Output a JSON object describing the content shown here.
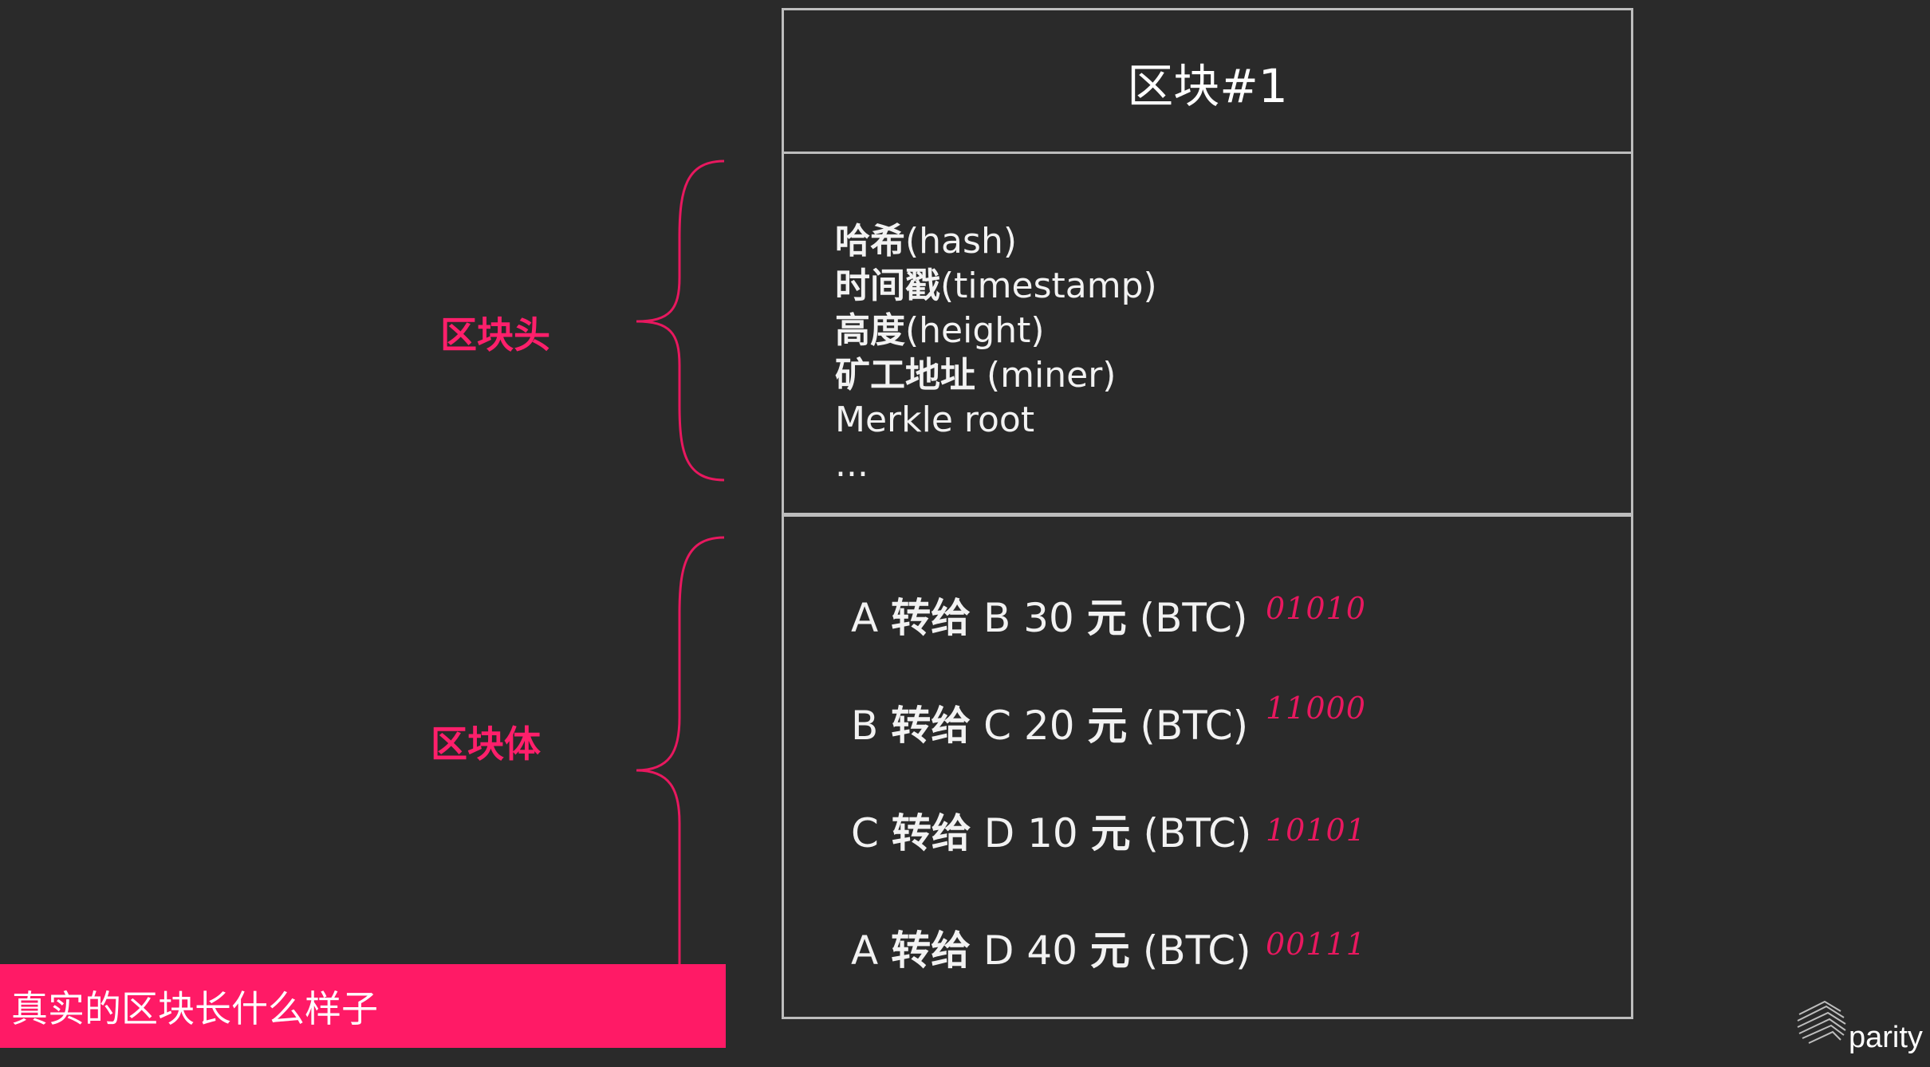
{
  "block": {
    "title": "区块#1",
    "header_fields": [
      {
        "zh": "哈希",
        "en": "(hash)"
      },
      {
        "zh": "时间戳",
        "en": "(timestamp)"
      },
      {
        "zh": "高度",
        "en": "(height)"
      },
      {
        "zh": "矿工地址",
        "en": " (miner)"
      },
      {
        "zh": "",
        "en": "Merkle root"
      },
      {
        "zh": "",
        "en": "..."
      }
    ],
    "transactions": [
      {
        "from": "A ",
        "verb": "转给",
        "to": " B 30 ",
        "unit": "元",
        "coin": " (BTC)",
        "bits": "01010"
      },
      {
        "from": "B ",
        "verb": "转给",
        "to": " C 20 ",
        "unit": "元",
        "coin": " (BTC)",
        "bits": "11000"
      },
      {
        "from": "C ",
        "verb": "转给",
        "to": " D 10 ",
        "unit": "元",
        "coin": " (BTC)",
        "bits": "10101"
      },
      {
        "from": "A ",
        "verb": "转给",
        "to": " D 40 ",
        "unit": "元",
        "coin": " (BTC)",
        "bits": "00111"
      }
    ]
  },
  "labels": {
    "block_header": "区块头",
    "block_body": "区块体"
  },
  "banner": {
    "text": "真实的区块长什么样子"
  },
  "logo": {
    "text": "parity",
    "icon": "parity-logo-icon"
  },
  "colors": {
    "background": "#2a2a2a",
    "accent": "#ff1a66",
    "border": "#bdbdbd",
    "text": "#ffffff"
  }
}
